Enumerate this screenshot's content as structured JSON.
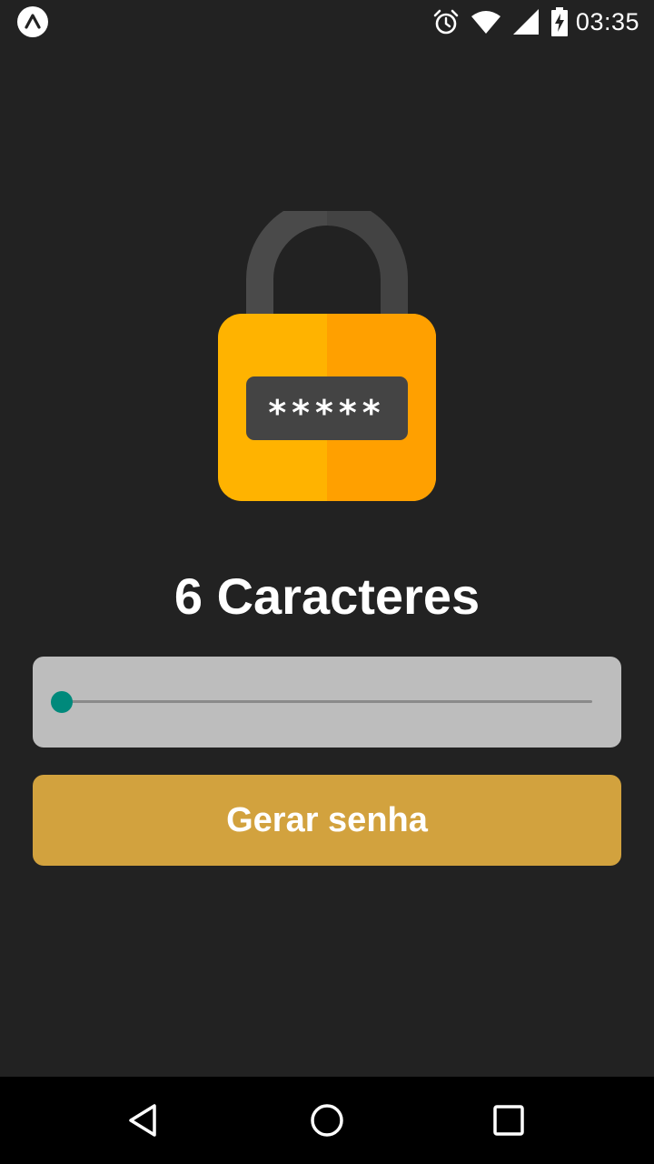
{
  "status_bar": {
    "time": "03:35",
    "icons": [
      "expo-icon",
      "alarm-icon",
      "wifi-icon",
      "signal-icon",
      "battery-charging-icon"
    ]
  },
  "main": {
    "title": "6 Caracteres",
    "slider": {
      "value": 6,
      "level": 0
    },
    "generate_button_label": "Gerar senha"
  },
  "lock_illustration": {
    "masked_chars": "*****",
    "colors": {
      "shackle": "#4a4a4a",
      "body_left": "#ffb300",
      "body_right": "#ffa000",
      "display": "#444444"
    }
  },
  "navigation_bar": {
    "icons": [
      "back-icon",
      "home-icon",
      "recents-icon"
    ]
  },
  "colors": {
    "background": "#222222",
    "slider_card": "#bdbdbd",
    "slider_thumb": "#00897b",
    "button": "#d2a23e",
    "text": "#ffffff"
  }
}
